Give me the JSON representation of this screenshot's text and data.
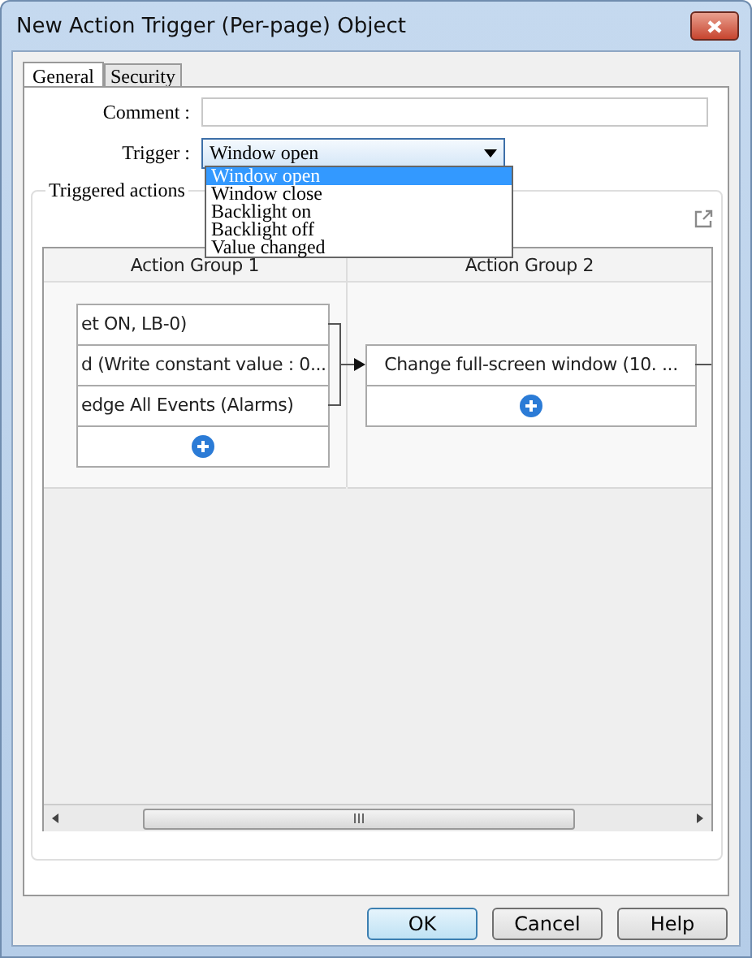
{
  "window": {
    "title": "New Action Trigger (Per-page) Object"
  },
  "tabs": [
    {
      "label": "General",
      "selected": true
    },
    {
      "label": "Security",
      "selected": false
    }
  ],
  "comment": {
    "label": "Comment :"
  },
  "trigger": {
    "label": "Trigger :",
    "value": "Window open",
    "expanded": true,
    "options": [
      {
        "label": "Window open",
        "selected": true
      },
      {
        "label": "Window close",
        "selected": false
      },
      {
        "label": "Backlight on",
        "selected": false
      },
      {
        "label": "Backlight off",
        "selected": false
      },
      {
        "label": "Value changed",
        "selected": false
      }
    ]
  },
  "triggered_actions": {
    "title": "Triggered actions",
    "groups": [
      {
        "title": "Action Group 1",
        "actions": [
          "et ON, LB-0)",
          "d (Write constant value : 0...",
          "edge All Events (Alarms)"
        ]
      },
      {
        "title": "Action Group 2",
        "actions": [
          "Change full-screen window (10. ..."
        ]
      }
    ]
  },
  "buttons": [
    {
      "label": "OK",
      "default": true
    },
    {
      "label": "Cancel",
      "default": false
    },
    {
      "label": "Help",
      "default": false
    }
  ]
}
